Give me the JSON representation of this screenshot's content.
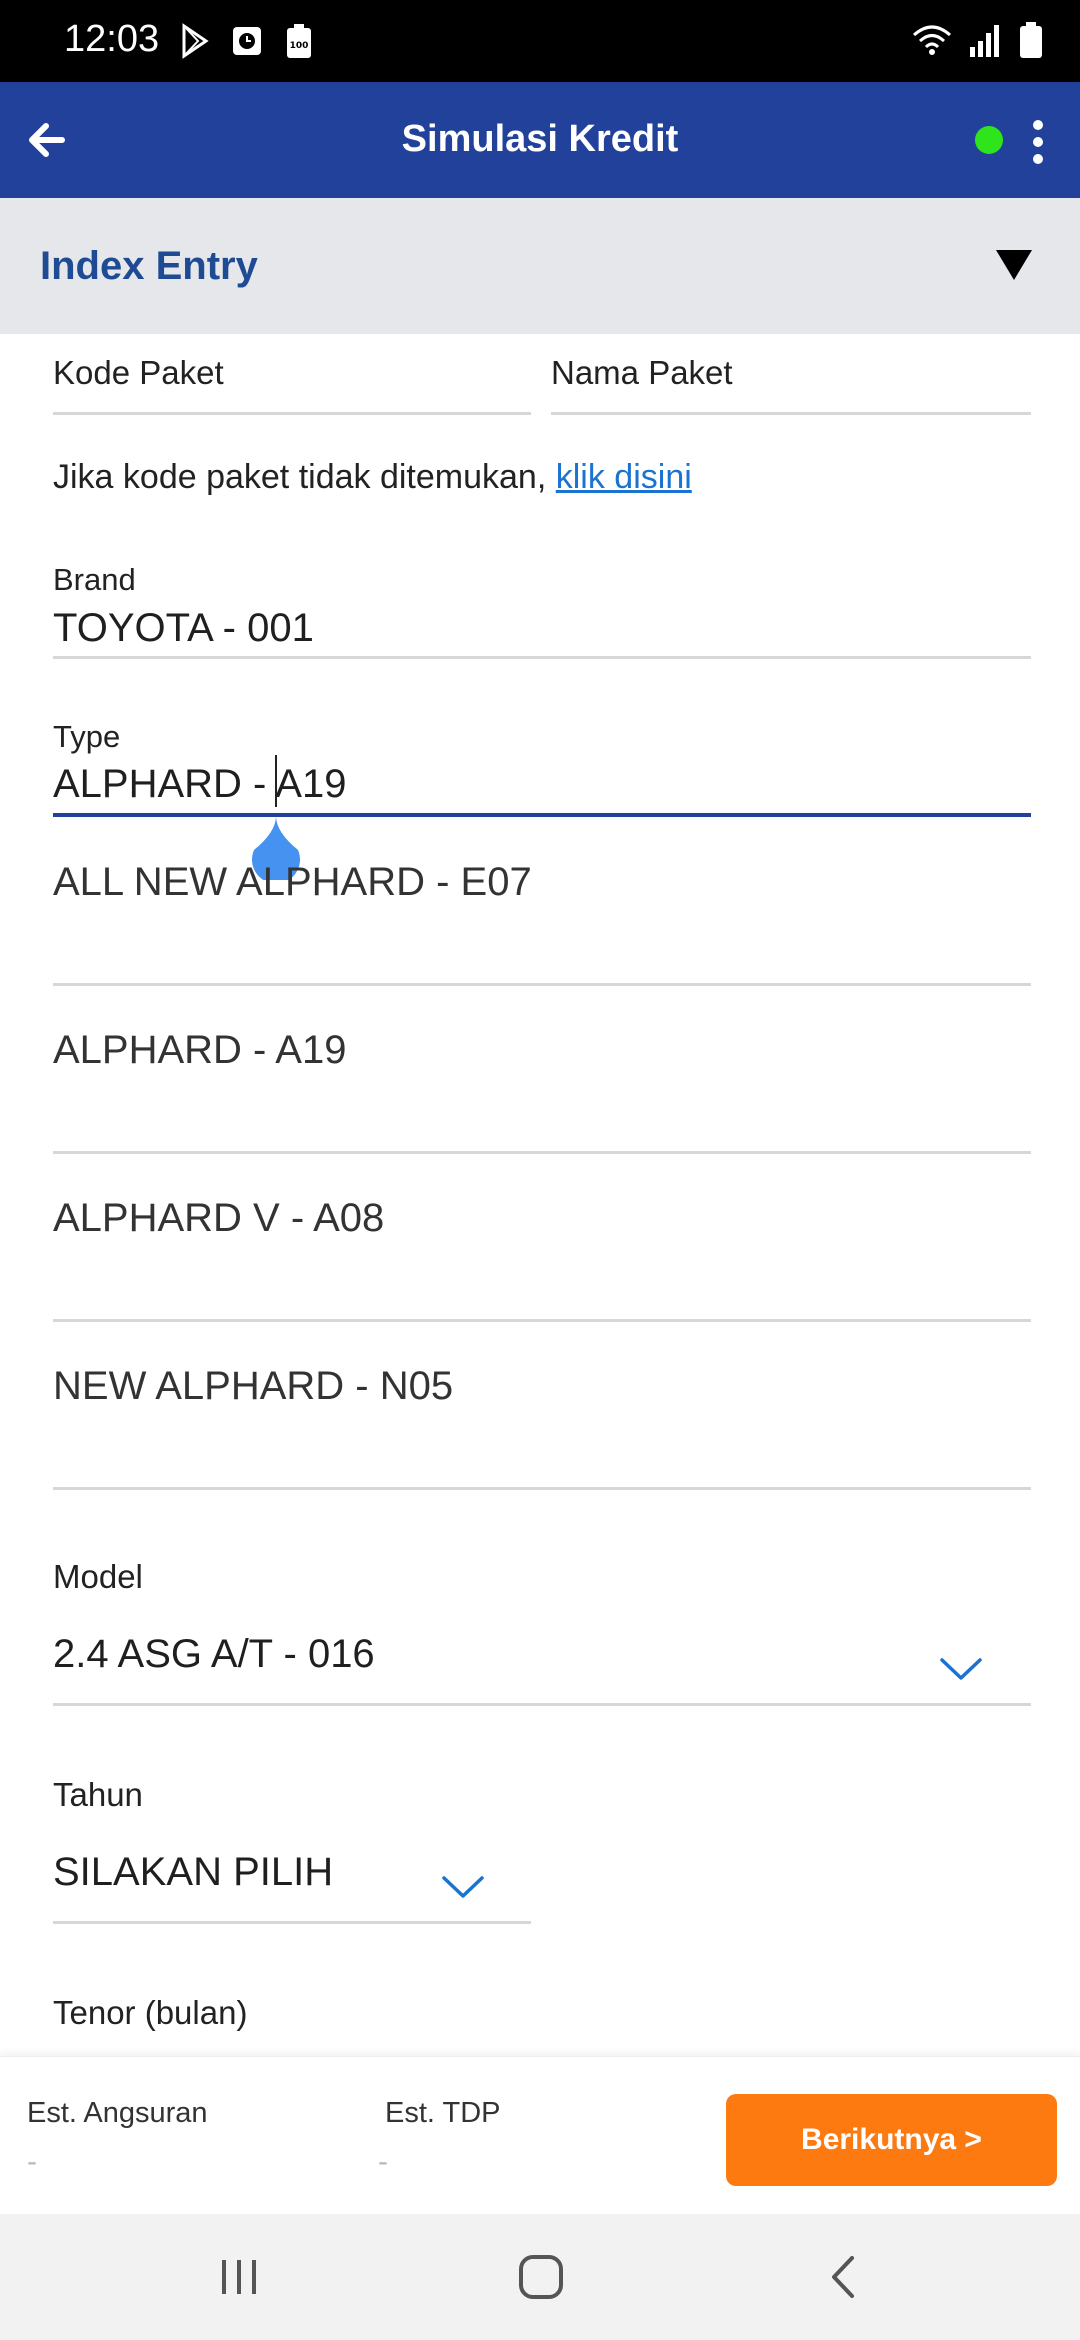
{
  "status_bar": {
    "time": "12:03",
    "battery_saver_label": "100"
  },
  "app_bar": {
    "title": "Simulasi Kredit"
  },
  "section": {
    "title": "Index Entry"
  },
  "fields": {
    "kode_paket_label": "Kode Paket",
    "nama_paket_label": "Nama Paket",
    "hint_text": "Jika kode paket tidak ditemukan,",
    "hint_link": "klik disini",
    "brand_label": "Brand",
    "brand_value": "TOYOTA - 001",
    "type_label": "Type",
    "type_value": "ALPHARD - A19",
    "model_label": "Model",
    "model_value": "2.4 ASG A/T - 016",
    "tahun_label": "Tahun",
    "tahun_value": "SILAKAN PILIH",
    "tenor_label": "Tenor (bulan)"
  },
  "suggestions": [
    {
      "label": "ALL NEW ALPHARD - E07"
    },
    {
      "label": "ALPHARD - A19"
    },
    {
      "label": "ALPHARD V - A08"
    },
    {
      "label": "NEW ALPHARD - N05"
    }
  ],
  "bottom_bar": {
    "angsuran_label": "Est. Angsuran",
    "angsuran_value": "-",
    "tdp_label": "Est. TDP",
    "tdp_value": "-",
    "next_label": "Berikutnya >"
  },
  "colors": {
    "app_bar": "#22419a",
    "accent_orange": "#fd7a11",
    "online_dot": "#2ee51c",
    "link": "#1a73d1",
    "section_title": "#1f4b94"
  },
  "icons": [
    "back-arrow-icon",
    "more-vert-icon",
    "caret-down-icon",
    "chevron-down-icon",
    "recent-apps-icon",
    "home-icon",
    "back-nav-icon"
  ]
}
